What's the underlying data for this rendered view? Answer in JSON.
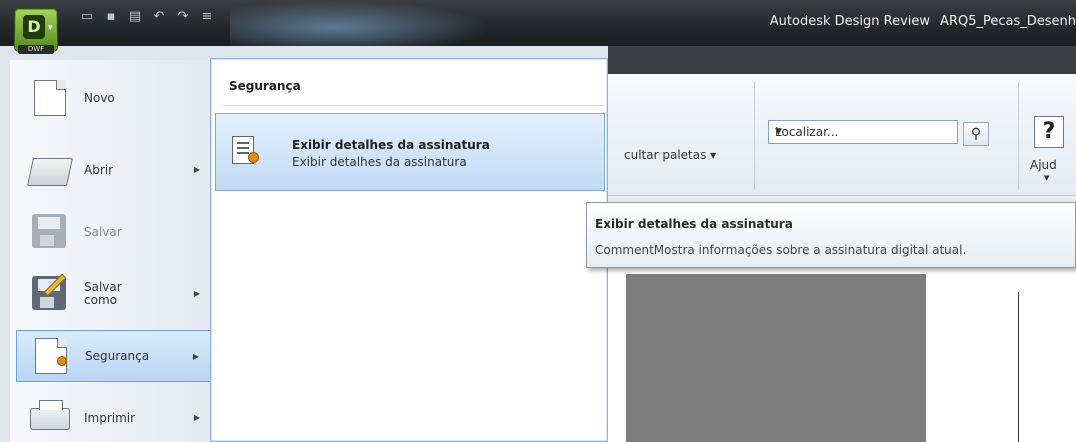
{
  "window": {
    "app_name": "Autodesk Design Review",
    "doc_name": "ARQ5_Pecas_Desenh",
    "app_button_tag": "DWF"
  },
  "quick_access": {
    "icons": [
      "new-doc-icon",
      "save-icon",
      "print-icon",
      "undo-icon",
      "redo-icon",
      "customize-icon"
    ]
  },
  "app_menu": {
    "items": [
      {
        "label": "Novo",
        "icon": "new-document-icon",
        "has_submenu": false,
        "enabled": true
      },
      {
        "label": "Abrir",
        "icon": "open-folder-icon",
        "has_submenu": true,
        "enabled": true
      },
      {
        "label": "Salvar",
        "icon": "save-icon",
        "has_submenu": false,
        "enabled": false
      },
      {
        "label": "Salvar",
        "label2": "como",
        "icon": "save-as-icon",
        "has_submenu": true,
        "enabled": true
      },
      {
        "label": "Segurança",
        "icon": "security-document-icon",
        "has_submenu": true,
        "enabled": true,
        "active": true
      },
      {
        "label": "Imprimir",
        "icon": "printer-icon",
        "has_submenu": true,
        "enabled": true
      }
    ]
  },
  "submenu": {
    "header": "Segurança",
    "items": [
      {
        "title": "Exibir detalhes da assinatura",
        "description": "Exibir detalhes da assinatura",
        "icon": "signature-details-icon"
      }
    ]
  },
  "ribbon": {
    "palettes_label": "cultar paletas",
    "search_placeholder": "Localizar...",
    "help_label": "Ajud",
    "help_glyph": "?"
  },
  "tooltip": {
    "title": "Exibir detalhes da assinatura",
    "body": "CommentMostra informações sobre a assinatura digital atual."
  },
  "colors": {
    "accent": "#6ea2d6",
    "app_button": "#4f8a1c",
    "titlebar": "#24272b"
  }
}
